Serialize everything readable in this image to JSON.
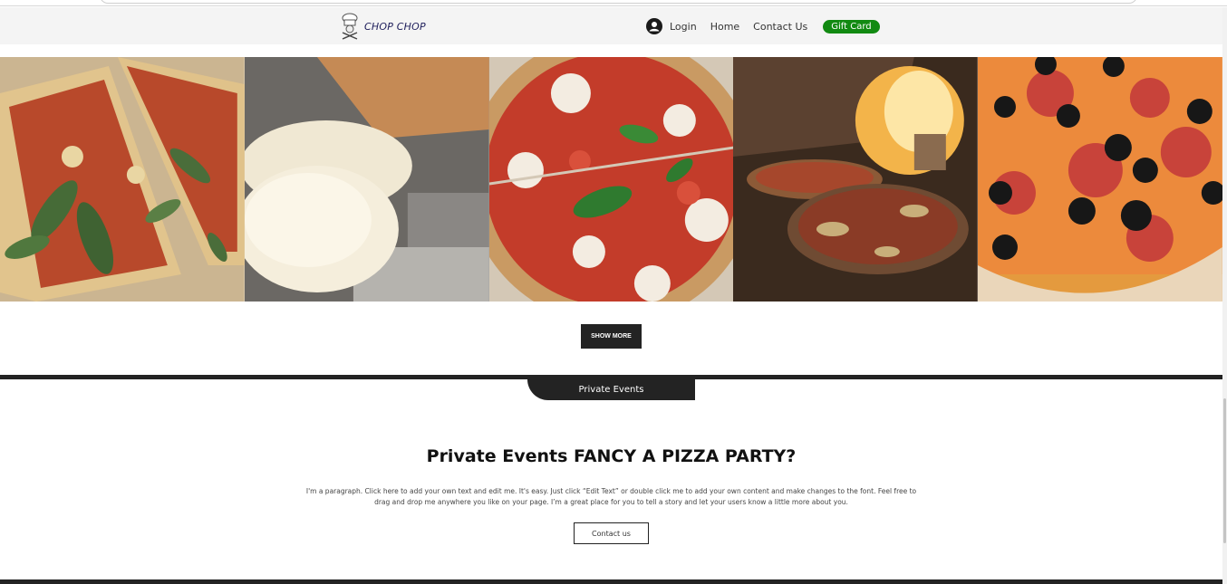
{
  "header": {
    "logo_text": "CHOP CHOP",
    "nav": {
      "login": "Login",
      "home": "Home",
      "contact": "Contact Us",
      "gift_card": "Gift Card"
    }
  },
  "gallery": {
    "images": [
      "basil-pizza-slices-icon",
      "pizza-dough-icon",
      "margherita-pizza-icon",
      "wood-fired-oven-pizza-icon",
      "pepperoni-olive-pizza-icon"
    ],
    "show_more_label": "SHOW MORE"
  },
  "private_events": {
    "tab_label": "Private Events",
    "heading": "Private Events FANCY A PIZZA PARTY?",
    "paragraph": "I'm a paragraph. Click here to add your own text and edit me. It's easy. Just click “Edit Text” or double click me to add your own content and make changes to the font. Feel free to drag and drop me anywhere you like on your page. I’m a great place for you to tell a story and let your users know a little more about you.",
    "contact_label": "Contact us"
  },
  "colors": {
    "gift_card_bg": "#128a12",
    "dark": "#232323",
    "header_bg": "#f4f4f4"
  }
}
